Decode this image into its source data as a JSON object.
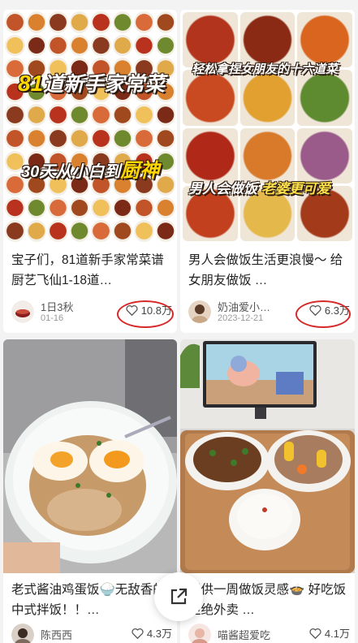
{
  "posts": [
    {
      "cover_text_1_num": "81",
      "cover_text_1": "道新手家常菜",
      "cover_text_2a": "30天从小白到",
      "cover_text_2b": "厨神",
      "title": "宝子们，81道新手家常菜谱厨艺飞仙1-18道…",
      "author": "1日3秋",
      "date": "01-16",
      "likes": "10.8万"
    },
    {
      "cover_text_1": "轻松拿捏女朋友的十六道菜",
      "cover_text_2a": "男人会做饭",
      "cover_text_2b": "老婆更可爱",
      "title": "男人会做饭生活更浪慢～ 给女朋友做饭 …",
      "author": "奶油爱小…",
      "date": "2023-12-21",
      "likes": "6.3万"
    },
    {
      "title": "老式酱油鸡蛋饭🍚无敌香的中式拌饭！！…",
      "author": "陈西西",
      "likes": "4.3万"
    },
    {
      "title": "提供一周做饭灵感🍲 好吃饭 拒绝外卖 …",
      "author": "喵酱超爱吃",
      "likes": "4.1万"
    }
  ],
  "share_icon": "share-icon",
  "colors": {
    "highlight_circle": "#d62828",
    "cover_yellow": "#ffd800"
  }
}
